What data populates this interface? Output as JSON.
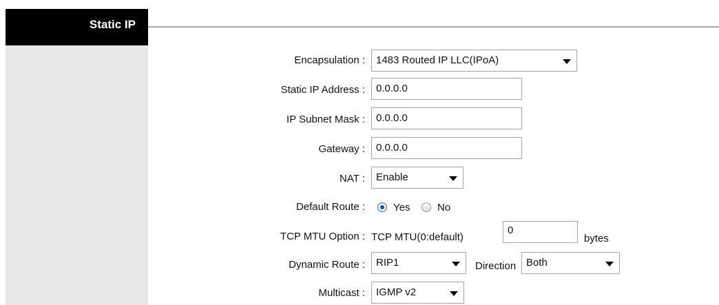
{
  "section": {
    "title": "Static IP"
  },
  "form": {
    "encapsulation": {
      "label": "Encapsulation :",
      "value": "1483 Routed IP LLC(IPoA)"
    },
    "static_ip": {
      "label": "Static IP Address :",
      "value": "0.0.0.0"
    },
    "subnet_mask": {
      "label": "IP Subnet Mask :",
      "value": "0.0.0.0"
    },
    "gateway": {
      "label": "Gateway :",
      "value": "0.0.0.0"
    },
    "nat": {
      "label": "NAT :",
      "value": "Enable"
    },
    "default_route": {
      "label": "Default Route :",
      "options": [
        "Yes",
        "No"
      ],
      "selected": "Yes"
    },
    "tcp_mtu": {
      "label": "TCP MTU Option :",
      "prefix": "TCP MTU(0:default)",
      "value": "0",
      "unit": "bytes"
    },
    "dynamic_route": {
      "label": "Dynamic Route :",
      "value": "RIP1",
      "direction_label": "Direction",
      "direction_value": "Both"
    },
    "multicast": {
      "label": "Multicast :",
      "value": "IGMP v2"
    }
  }
}
